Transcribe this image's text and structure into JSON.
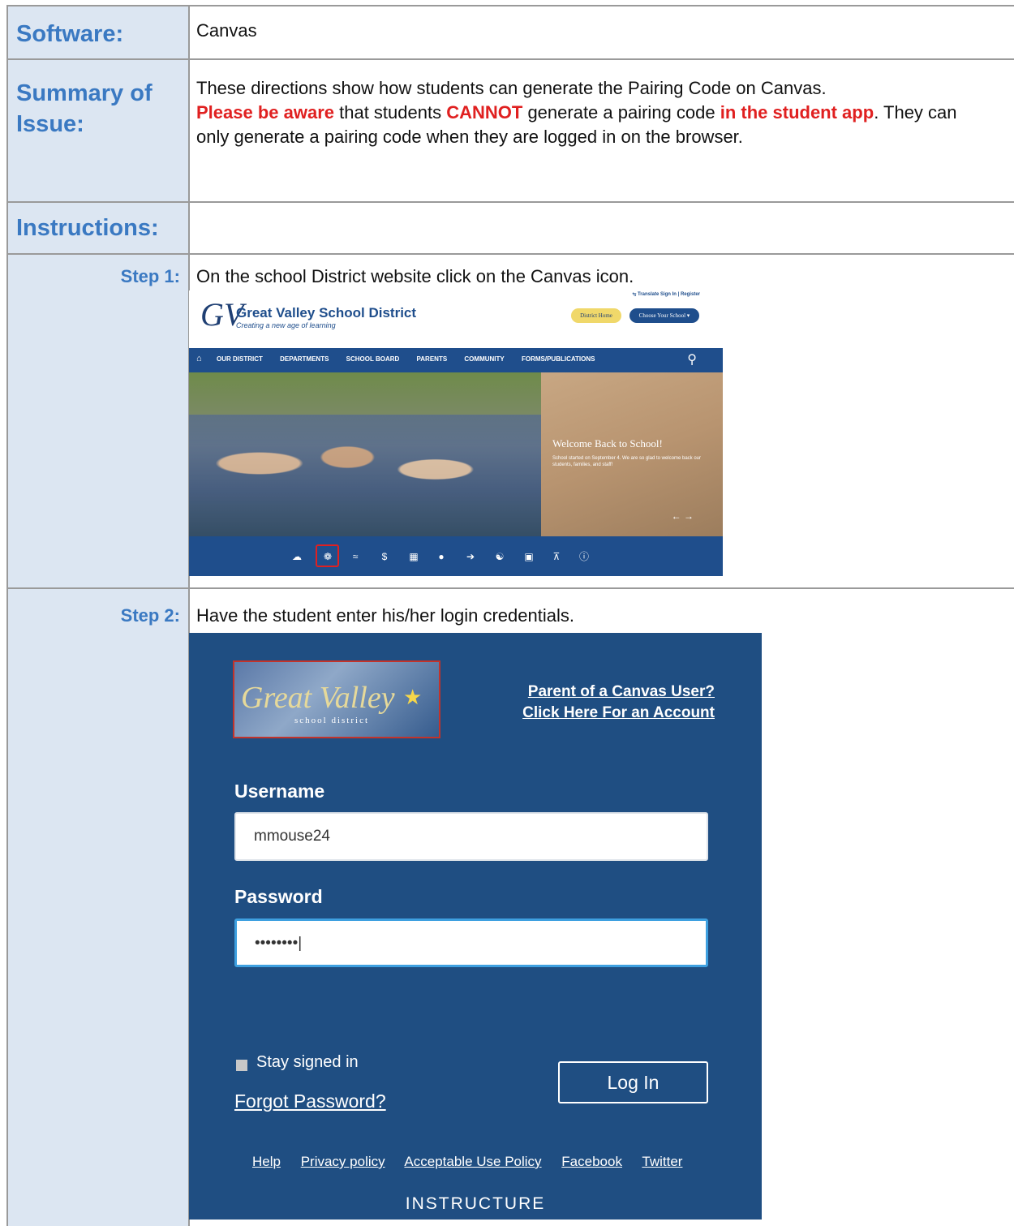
{
  "rows": {
    "software": {
      "label": "Software:",
      "value": "Canvas"
    },
    "summary": {
      "label_line1": "Summary of",
      "label_line2": "Issue:",
      "text_1": "These directions show how students can generate the Pairing Code on Canvas.",
      "text_red_1": "Please be aware",
      "text_2": " that students ",
      "text_red_2": "CANNOT",
      "text_3": " generate a pairing code ",
      "text_red_3": "in the student app",
      "text_4": ". They can only generate a pairing code when they are logged in on the browser."
    },
    "instructions": {
      "label": "Instructions:"
    },
    "step1": {
      "label": "Step 1:",
      "text": "On the school District website click on the Canvas icon."
    },
    "step2": {
      "label": "Step 2:",
      "text": "Have the student enter his/her login credentials."
    }
  },
  "website": {
    "logo": "GV",
    "title": "Great Valley School District",
    "tagline": "Creating a new age of learning",
    "top_links": "⥃ Translate   Sign In  |  Register",
    "district_home": "District Home",
    "choose_school": "Choose Your School ▾",
    "nav_items": [
      "OUR DISTRICT",
      "DEPARTMENTS",
      "SCHOOL BOARD",
      "PARENTS",
      "COMMUNITY",
      "FORMS/PUBLICATIONS"
    ],
    "slide_title": "Welcome Back to School!",
    "slide_text": "School started on September 4. We are so glad to welcome back our students, families, and staff!",
    "icon_names": [
      "cloud-icon",
      "canvas-icon",
      "swoosh-icon",
      "dollar-icon",
      "calendar-icon",
      "apple-icon",
      "handshake-icon",
      "people-icon",
      "bus-icon",
      "bridge-icon",
      "info-icon"
    ]
  },
  "login": {
    "logo_text": "Great Valley",
    "logo_sub": "school district",
    "parent_link_1": "Parent of a Canvas User?",
    "parent_link_2": "Click Here For an Account",
    "username_label": "Username",
    "username_value": "mmouse24",
    "password_label": "Password",
    "password_value": "••••••••|",
    "stay_signed_in": "Stay signed in",
    "forgot": "Forgot Password?",
    "login_button": "Log In",
    "footer_links": [
      "Help",
      "Privacy policy",
      "Acceptable Use Policy",
      "Facebook",
      "Twitter"
    ],
    "brand": "INSTRUCTURE"
  },
  "colors": {
    "label_bg": "#dce6f2",
    "label_text": "#3a79c2",
    "alert_red": "#e02020",
    "site_blue": "#1f4e8c",
    "login_blue": "#1f4e82"
  }
}
